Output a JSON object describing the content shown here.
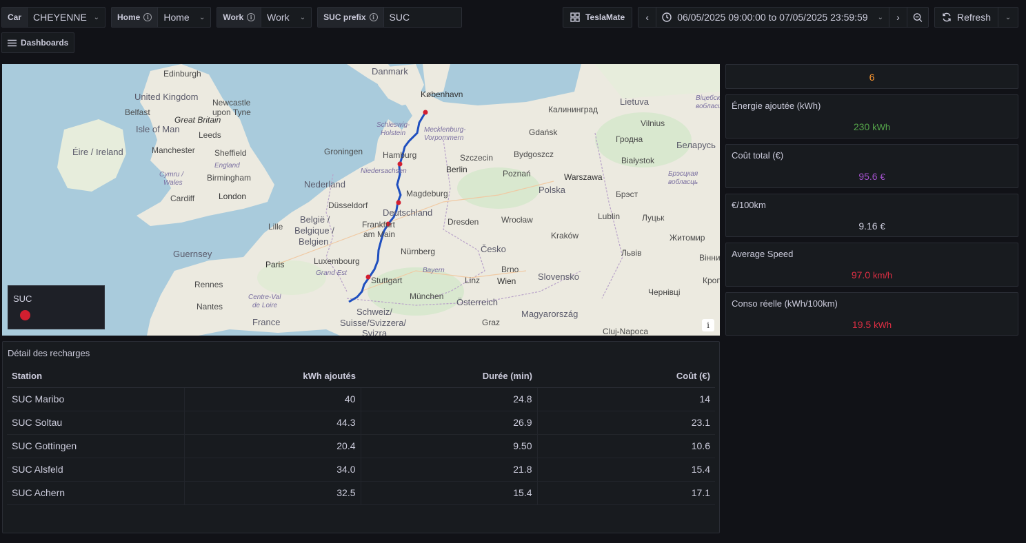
{
  "variables": [
    {
      "label": "Car",
      "value": "CHEYENNE",
      "info": false,
      "dropdown": true
    },
    {
      "label": "Home",
      "value": "Home",
      "info": true,
      "dropdown": true
    },
    {
      "label": "Work",
      "value": "Work",
      "info": true,
      "dropdown": true
    },
    {
      "label": "SUC prefix",
      "value": "SUC",
      "info": true,
      "dropdown": false
    }
  ],
  "toolbar": {
    "dashboard_link": "TeslaMate",
    "time_range": "06/05/2025 09:00:00 to 07/05/2025 23:59:59",
    "refresh_label": "Refresh",
    "dashboards_label": "Dashboards"
  },
  "map": {
    "legend_title": "SUC",
    "legend_color": "#d21f30",
    "route_color": "#1f4fbf",
    "info_glyph": "i",
    "labels": {
      "danmark": "Danmark",
      "kobenhavn": "København",
      "edinburgh": "Edinburgh",
      "uk": "United Kingdom",
      "newcastle1": "Newcastle",
      "newcastle2": "upon Tyne",
      "belfast": "Belfast",
      "greatbritain": "Great Britain",
      "isleofman": "Isle of Man",
      "leeds": "Leeds",
      "eire": "Éire / Ireland",
      "manchester": "Manchester",
      "sheffield": "Sheffield",
      "england": "England",
      "cymru1": "Cymru /",
      "cymru2": "Wales",
      "birmingham": "Birmingham",
      "cardiff": "Cardiff",
      "london": "London",
      "groningen": "Groningen",
      "hamburg": "Hamburg",
      "schleswig1": "Schleswig-",
      "schleswig2": "Holstein",
      "mecklenburg1": "Mecklenburg-",
      "mecklenburg2": "Vorpommern",
      "kaliningrad": "Калининград",
      "lietuva": "Lietuva",
      "vilnius": "Vilnius",
      "gdansk": "Gdańsk",
      "hrodna": "Гродна",
      "belarus": "Беларусь",
      "szczecin": "Szczecin",
      "bydgoszcz": "Bydgoszcz",
      "bialystok": "Białystok",
      "nederland": "Nederland",
      "niedersachsen": "Niedersachsen",
      "berlin": "Berlin",
      "poznan": "Poznań",
      "warszawa": "Warszawa",
      "polska": "Polska",
      "brest": "Брэст",
      "magdeburg": "Magdeburg",
      "dusseldorf": "Düsseldorf",
      "deutschland": "Deutschland",
      "lille": "Lille",
      "belgie1": "België /",
      "belgie2": "Belgique /",
      "belgie3": "Belgien",
      "frankfurt1": "Frankfurt",
      "frankfurt2": "am Main",
      "dresden": "Dresden",
      "wroclaw": "Wrocław",
      "lublin": "Lublin",
      "lutsk": "Луцьк",
      "guernsey": "Guernsey",
      "krakow": "Kraków",
      "zhytomyr": "Житомир",
      "cesko": "Česko",
      "nurnberg": "Nürnberg",
      "luxembourg": "Luxembourg",
      "paris": "Paris",
      "lviv": "Львів",
      "brno": "Brno",
      "bayern": "Bayern",
      "grandest": "Grand Est",
      "stuttgart": "Stuttgart",
      "linz": "Linz",
      "wien": "Wien",
      "slovensko": "Slovensko",
      "rennes": "Rennes",
      "munchen": "München",
      "centre1": "Centre-Val",
      "centre2": "de Loire",
      "nantes": "Nantes",
      "osterreich": "Österreich",
      "chernivtsi": "Чернівці",
      "schweiz1": "Schweiz/",
      "schweiz2": "Suisse/Svizzera/",
      "schweiz3": "Svizra",
      "france": "France",
      "graz": "Graz",
      "magyarorszag": "Magyarország",
      "cluj": "Cluj-Napoca",
      "vitsebsk1": "Віцебск",
      "vitsebsk2": "вобласць",
      "brest_obl1": "Брэсцкая",
      "brest_obl2": "вобласць",
      "vinnytsia": "Вінниц",
      "krop": "Кроп"
    }
  },
  "stats": [
    {
      "title": "",
      "value": "6",
      "unit": "",
      "color": "#ff9830"
    },
    {
      "title": "Énergie ajoutée (kWh)",
      "value": "230",
      "unit": "kWh",
      "color": "#56a64b"
    },
    {
      "title": "Coût total (€)",
      "value": "95.6",
      "unit": "€",
      "color": "#a352cc"
    },
    {
      "title": "€/100km",
      "value": "9.16",
      "unit": "€",
      "color": "#ccccdc"
    },
    {
      "title": "Average Speed",
      "value": "97.0",
      "unit": "km/h",
      "color": "#e02f44"
    },
    {
      "title": "Conso réelle (kWh/100km)",
      "value": "19.5",
      "unit": "kWh",
      "color": "#e02f44"
    }
  ],
  "table": {
    "title": "Détail des recharges",
    "headers": [
      "Station",
      "kWh ajoutés",
      "Durée (min)",
      "Coût (€)"
    ],
    "rows": [
      [
        "SUC Maribo",
        "40",
        "24.8",
        "14"
      ],
      [
        "SUC Soltau",
        "44.3",
        "26.9",
        "23.1"
      ],
      [
        "SUC Gottingen",
        "20.4",
        "9.50",
        "10.6"
      ],
      [
        "SUC Alsfeld",
        "34.0",
        "21.8",
        "15.4"
      ],
      [
        "SUC Achern",
        "32.5",
        "15.4",
        "17.1"
      ]
    ]
  }
}
